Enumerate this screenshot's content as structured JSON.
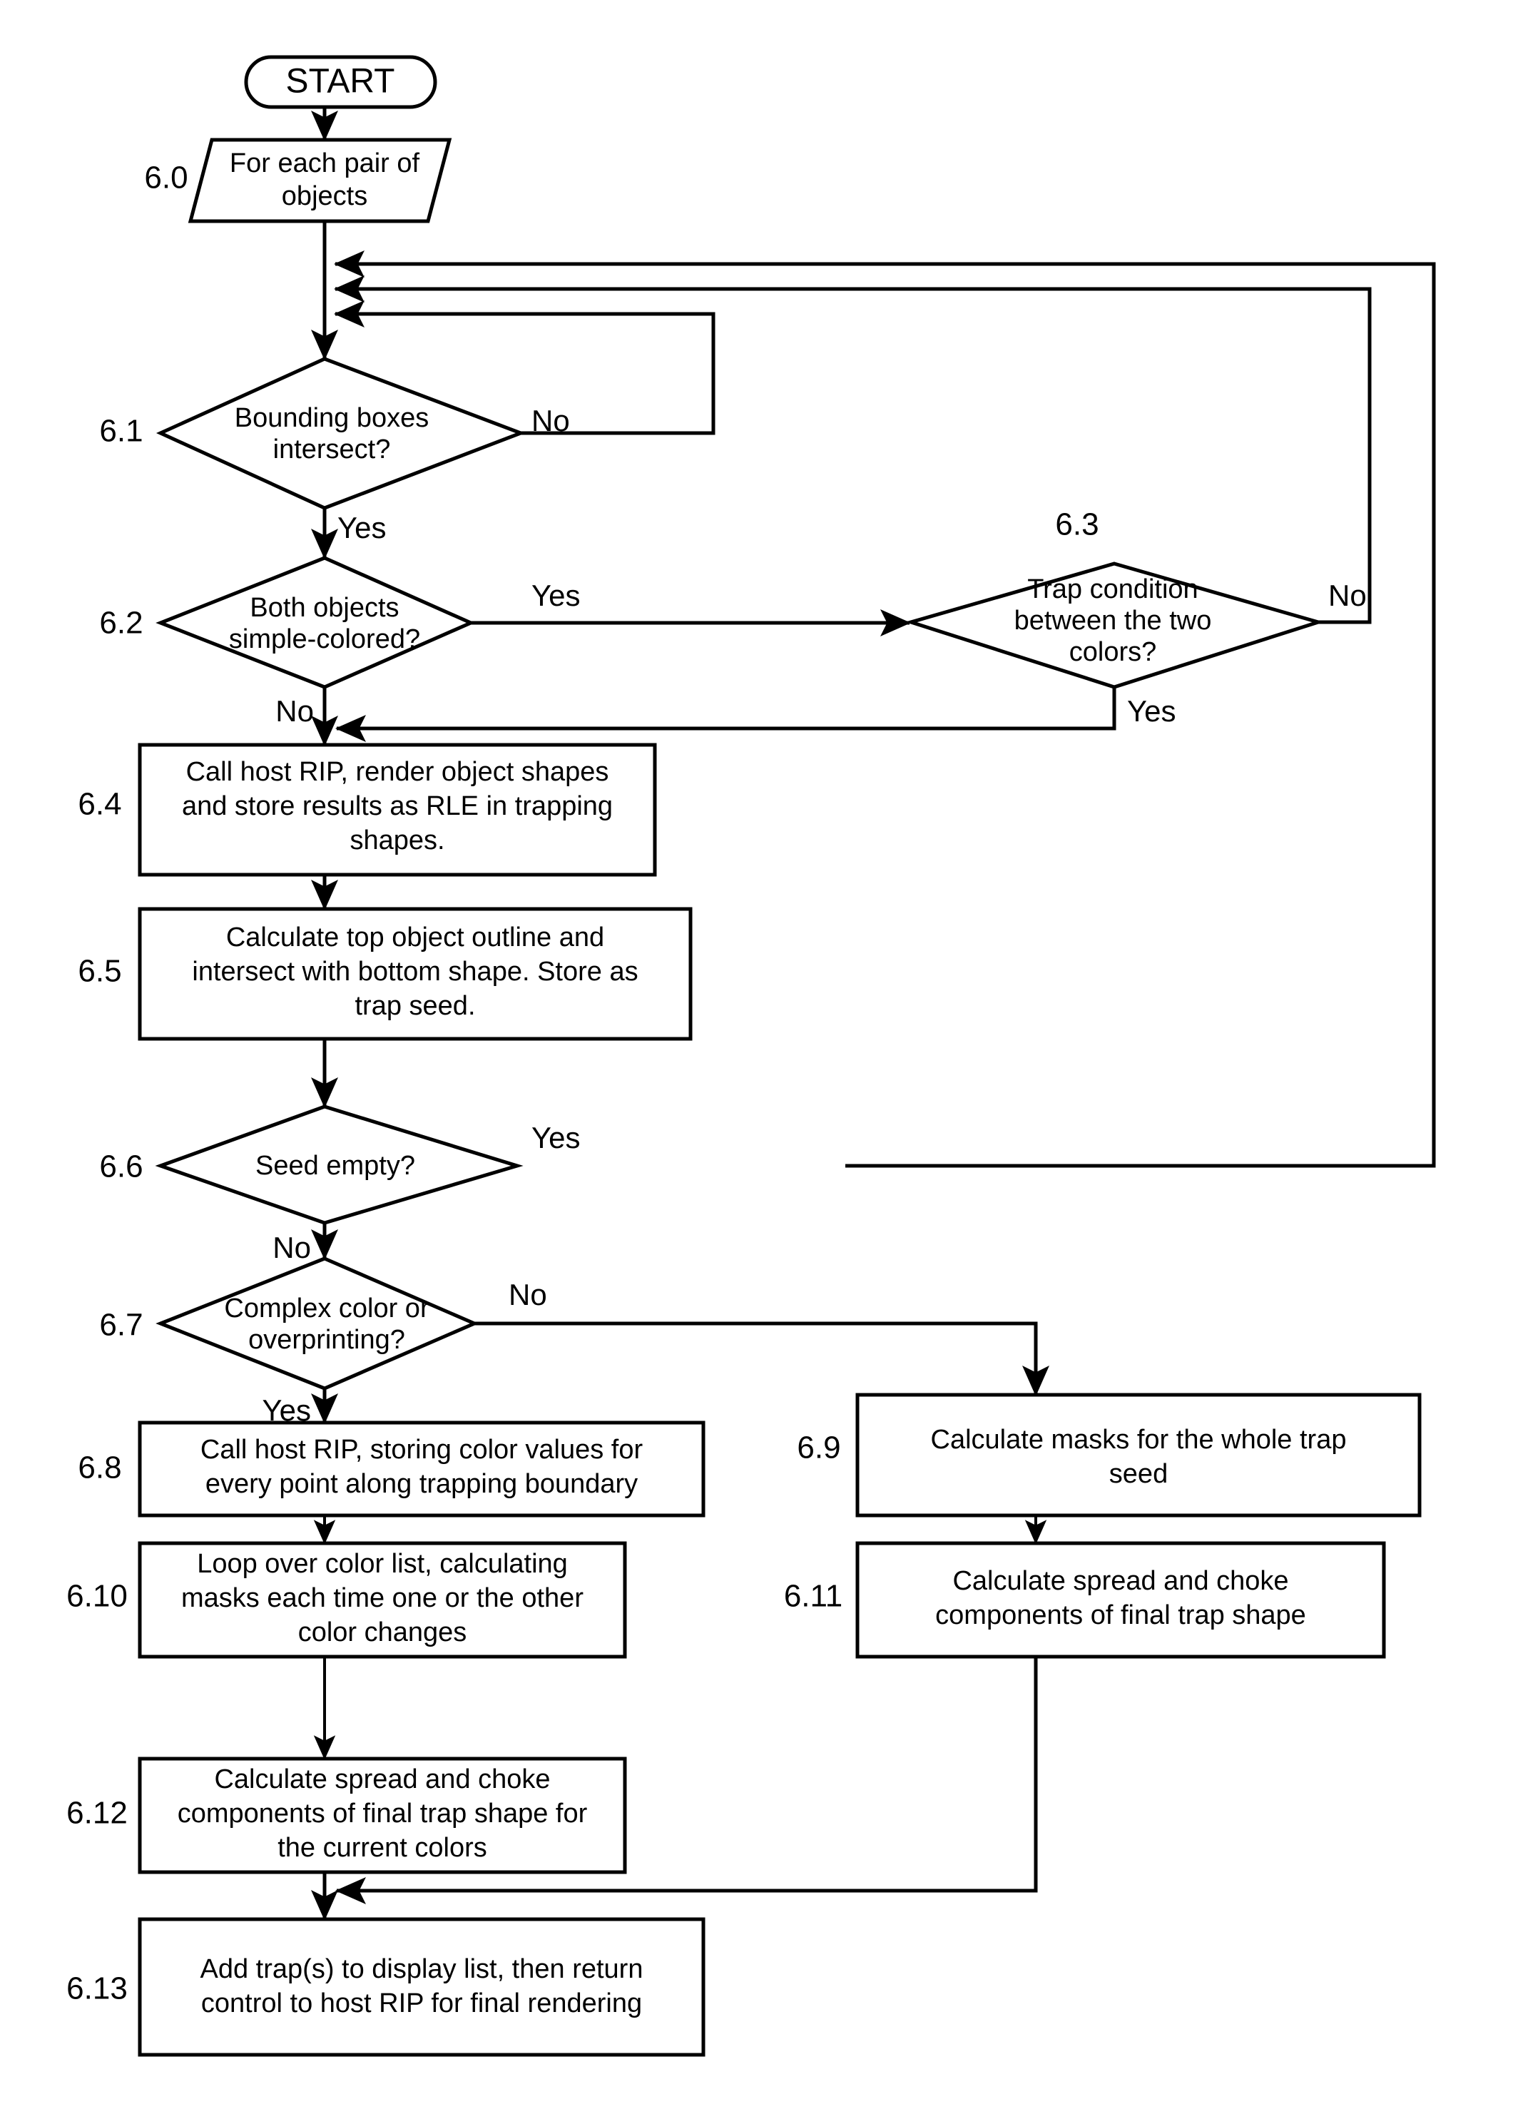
{
  "diagram": {
    "type": "flowchart",
    "title": "Trapping process flowchart",
    "orientation": "top-to-bottom",
    "line_color": "#000000",
    "fill_color": "#ffffff",
    "background": "#ffffff"
  },
  "nodes": {
    "start": {
      "shape": "terminator",
      "text": "START",
      "step": ""
    },
    "n60": {
      "shape": "parallelogram",
      "step": "6.0",
      "lines": [
        "For each pair of",
        "objects"
      ]
    },
    "n61": {
      "shape": "diamond",
      "step": "6.1",
      "lines": [
        "Bounding boxes",
        "intersect?"
      ]
    },
    "n62": {
      "shape": "diamond",
      "step": "6.2",
      "lines": [
        "Both objects",
        "simple-colored?"
      ]
    },
    "n63": {
      "shape": "diamond",
      "step": "6.3",
      "lines": [
        "Trap condition",
        "between the two",
        "colors?"
      ]
    },
    "n64": {
      "shape": "rectangle",
      "step": "6.4",
      "lines": [
        "Call host RIP, render object shapes",
        "and store results as RLE in trapping",
        "shapes."
      ]
    },
    "n65": {
      "shape": "rectangle",
      "step": "6.5",
      "lines": [
        "Calculate top object outline and",
        "intersect with bottom shape. Store as",
        "trap seed."
      ]
    },
    "n66": {
      "shape": "diamond",
      "step": "6.6",
      "lines": [
        "Seed empty?"
      ]
    },
    "n67": {
      "shape": "diamond",
      "step": "6.7",
      "lines": [
        "Complex color or",
        "overprinting?"
      ]
    },
    "n68": {
      "shape": "rectangle",
      "step": "6.8",
      "lines": [
        "Call host RIP, storing color values for",
        "every point along trapping boundary"
      ]
    },
    "n69": {
      "shape": "rectangle",
      "step": "6.9",
      "lines": [
        "Calculate masks for the whole trap",
        "seed"
      ]
    },
    "n610": {
      "shape": "rectangle",
      "step": "6.10",
      "lines": [
        "Loop over color list, calculating",
        "masks each time one or the other",
        "color changes"
      ]
    },
    "n611": {
      "shape": "rectangle",
      "step": "6.11",
      "lines": [
        "Calculate spread and choke",
        "components of final trap shape"
      ]
    },
    "n612": {
      "shape": "rectangle",
      "step": "6.12",
      "lines": [
        "Calculate spread and choke",
        "components of final trap shape for",
        "the current colors"
      ]
    },
    "n613": {
      "shape": "rectangle",
      "step": "6.13",
      "lines": [
        "Add trap(s) to display list, then return",
        "control to host RIP for final rendering"
      ]
    }
  },
  "edge_labels": {
    "e61_no": "No",
    "e61_yes": "Yes",
    "e62_yes": "Yes",
    "e62_no": "No",
    "e63_no": "No",
    "e63_yes": "Yes",
    "e66_yes": "Yes",
    "e66_no": "No",
    "e67_no": "No",
    "e67_yes": "Yes"
  },
  "edges": [
    {
      "from": "start",
      "to": "n60",
      "label": ""
    },
    {
      "from": "n60",
      "to": "n61",
      "label": ""
    },
    {
      "from": "n61",
      "to": "n61",
      "label": "No",
      "note": "loops back above 6.1"
    },
    {
      "from": "n61",
      "to": "n62",
      "label": "Yes"
    },
    {
      "from": "n62",
      "to": "n63",
      "label": "Yes"
    },
    {
      "from": "n62",
      "to": "n64",
      "label": "No"
    },
    {
      "from": "n63",
      "to": "n61",
      "label": "No",
      "note": "loops back above 6.1"
    },
    {
      "from": "n63",
      "to": "n64",
      "label": "Yes"
    },
    {
      "from": "n64",
      "to": "n65",
      "label": ""
    },
    {
      "from": "n65",
      "to": "n66",
      "label": ""
    },
    {
      "from": "n66",
      "to": "n61",
      "label": "Yes",
      "note": "loops back above 6.1"
    },
    {
      "from": "n66",
      "to": "n67",
      "label": "No"
    },
    {
      "from": "n67",
      "to": "n69",
      "label": "No"
    },
    {
      "from": "n67",
      "to": "n68",
      "label": "Yes"
    },
    {
      "from": "n68",
      "to": "n610",
      "label": ""
    },
    {
      "from": "n69",
      "to": "n611",
      "label": ""
    },
    {
      "from": "n610",
      "to": "n612",
      "label": ""
    },
    {
      "from": "n611",
      "to": "n613",
      "label": ""
    },
    {
      "from": "n612",
      "to": "n613",
      "label": ""
    }
  ]
}
